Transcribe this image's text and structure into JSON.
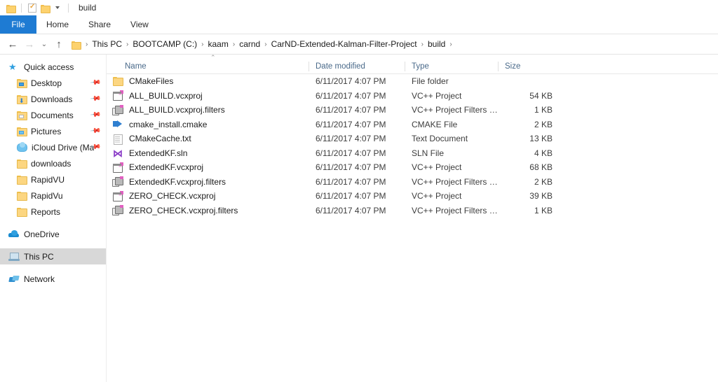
{
  "window": {
    "title": "build",
    "quick_access_toolbar": [
      {
        "name": "folder-icon",
        "label": ""
      },
      {
        "name": "properties-icon",
        "label": ""
      },
      {
        "name": "new-folder-icon",
        "label": ""
      },
      {
        "name": "chevron-down-icon",
        "label": ""
      }
    ]
  },
  "ribbon": {
    "tabs": [
      {
        "label": "File",
        "active": true
      },
      {
        "label": "Home",
        "active": false
      },
      {
        "label": "Share",
        "active": false
      },
      {
        "label": "View",
        "active": false
      }
    ]
  },
  "navigation": {
    "back_label": "←",
    "forward_label": "→",
    "recent_label": "⌄",
    "up_label": "↑",
    "breadcrumbs": [
      "This PC",
      "BOOTCAMP (C:)",
      "kaam",
      "carnd",
      "CarND-Extended-Kalman-Filter-Project",
      "build"
    ],
    "separator": "›"
  },
  "sidebar": {
    "groups": [
      {
        "root": {
          "label": "Quick access",
          "icon": "star-icon"
        },
        "items": [
          {
            "label": "Desktop",
            "icon": "folder-desktop-icon",
            "pinned": true
          },
          {
            "label": "Downloads",
            "icon": "folder-downloads-icon",
            "pinned": true
          },
          {
            "label": "Documents",
            "icon": "folder-documents-icon",
            "pinned": true
          },
          {
            "label": "Pictures",
            "icon": "folder-pictures-icon",
            "pinned": true
          },
          {
            "label": "iCloud Drive (Ma",
            "icon": "cloud-icon",
            "pinned": true
          },
          {
            "label": "downloads",
            "icon": "folder-icon",
            "pinned": false
          },
          {
            "label": "RapidVU",
            "icon": "folder-icon",
            "pinned": false
          },
          {
            "label": "RapidVu",
            "icon": "folder-icon",
            "pinned": false
          },
          {
            "label": "Reports",
            "icon": "folder-icon",
            "pinned": false
          }
        ]
      },
      {
        "root": {
          "label": "OneDrive",
          "icon": "onedrive-icon"
        },
        "items": []
      },
      {
        "root": {
          "label": "This PC",
          "icon": "computer-icon",
          "selected": true
        },
        "items": []
      },
      {
        "root": {
          "label": "Network",
          "icon": "network-icon"
        },
        "items": []
      }
    ]
  },
  "file_list": {
    "sort_indicator": "⌃",
    "columns": [
      {
        "label": "Name"
      },
      {
        "label": "Date modified"
      },
      {
        "label": "Type"
      },
      {
        "label": "Size"
      }
    ],
    "rows": [
      {
        "name": "CMakeFiles",
        "date": "6/11/2017 4:07 PM",
        "type": "File folder",
        "size": "",
        "icon": "folder-icon"
      },
      {
        "name": "ALL_BUILD.vcxproj",
        "date": "6/11/2017 4:07 PM",
        "type": "VC++ Project",
        "size": "54 KB",
        "icon": "vcxproj-icon"
      },
      {
        "name": "ALL_BUILD.vcxproj.filters",
        "date": "6/11/2017 4:07 PM",
        "type": "VC++ Project Filters …",
        "size": "1 KB",
        "icon": "vcxproj-filters-icon"
      },
      {
        "name": "cmake_install.cmake",
        "date": "6/11/2017 4:07 PM",
        "type": "CMAKE File",
        "size": "2 KB",
        "icon": "cmake-icon"
      },
      {
        "name": "CMakeCache.txt",
        "date": "6/11/2017 4:07 PM",
        "type": "Text Document",
        "size": "13 KB",
        "icon": "text-document-icon"
      },
      {
        "name": "ExtendedKF.sln",
        "date": "6/11/2017 4:07 PM",
        "type": "SLN File",
        "size": "4 KB",
        "icon": "visual-studio-solution-icon"
      },
      {
        "name": "ExtendedKF.vcxproj",
        "date": "6/11/2017 4:07 PM",
        "type": "VC++ Project",
        "size": "68 KB",
        "icon": "vcxproj-icon"
      },
      {
        "name": "ExtendedKF.vcxproj.filters",
        "date": "6/11/2017 4:07 PM",
        "type": "VC++ Project Filters …",
        "size": "2 KB",
        "icon": "vcxproj-filters-icon"
      },
      {
        "name": "ZERO_CHECK.vcxproj",
        "date": "6/11/2017 4:07 PM",
        "type": "VC++ Project",
        "size": "39 KB",
        "icon": "vcxproj-icon"
      },
      {
        "name": "ZERO_CHECK.vcxproj.filters",
        "date": "6/11/2017 4:07 PM",
        "type": "VC++ Project Filters …",
        "size": "1 KB",
        "icon": "vcxproj-filters-icon"
      }
    ]
  },
  "colors": {
    "accent": "#1e7bd3",
    "folder_yellow": "#fcd681",
    "selection_grey": "#d8d8d8",
    "header_text": "#4a6a8a",
    "vs_purple": "#8c3fc8",
    "magenta_badge": "#e05fc0"
  }
}
